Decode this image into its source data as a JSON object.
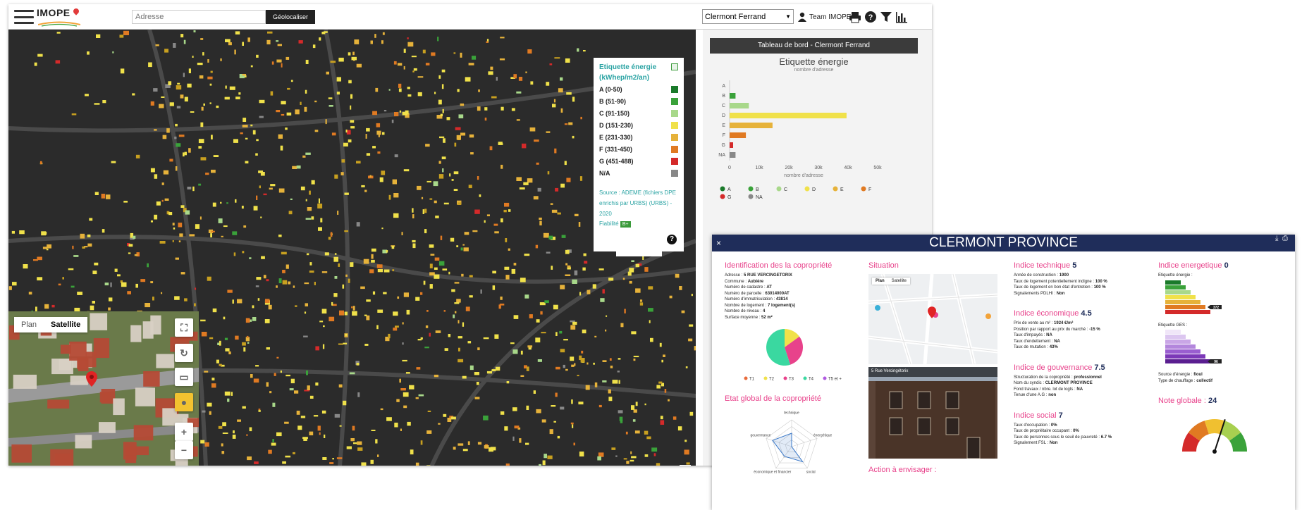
{
  "app": {
    "logo_text": "IMOPE",
    "address_placeholder": "Adresse",
    "geocode_button": "Géolocaliser",
    "city_selected": "Clermont Ferrand",
    "user_label": "Team IMOPE"
  },
  "legend": {
    "title": "Etiquette énergie (kWhep/m2/an)",
    "items": [
      {
        "label": "A (0-50)",
        "color": "#1a7a2a"
      },
      {
        "label": "B (51-90)",
        "color": "#3aa23a"
      },
      {
        "label": "C (91-150)",
        "color": "#a8d88a"
      },
      {
        "label": "D (151-230)",
        "color": "#f0e14a"
      },
      {
        "label": "E (231-330)",
        "color": "#e6b23a"
      },
      {
        "label": "F (331-450)",
        "color": "#e07a22"
      },
      {
        "label": "G (451-488)",
        "color": "#d42a2a"
      },
      {
        "label": "N/A",
        "color": "#888888"
      }
    ],
    "source": "Source : ADEME (fichiers DPE enrichis par URBS) (URBS) - 2020",
    "fidelity_label": "Fiabilité",
    "fidelity_value": "B+"
  },
  "satellite": {
    "tab_plan": "Plan",
    "tab_satellite": "Satellite"
  },
  "dashboard": {
    "header": "Tableau de bord - Clermont Ferrand",
    "chart_title": "Etiquette énergie",
    "chart_subtitle": "nombre d'adresse",
    "x_axis_label": "nombre d'adresse",
    "legend_items": [
      {
        "name": "A",
        "color": "#1a7a2a"
      },
      {
        "name": "B",
        "color": "#3aa23a"
      },
      {
        "name": "C",
        "color": "#a8d88a"
      },
      {
        "name": "D",
        "color": "#f0e14a"
      },
      {
        "name": "E",
        "color": "#e6b23a"
      },
      {
        "name": "F",
        "color": "#e07a22"
      },
      {
        "name": "G",
        "color": "#d42a2a"
      },
      {
        "name": "NA",
        "color": "#888888"
      }
    ]
  },
  "chart_data": {
    "type": "bar",
    "orientation": "horizontal",
    "categories": [
      "A",
      "B",
      "C",
      "D",
      "E",
      "F",
      "G",
      "NA"
    ],
    "values": [
      0,
      2000,
      6500,
      39500,
      14500,
      5500,
      1200,
      2000
    ],
    "xlabel": "nombre d'adresse",
    "xlim": [
      0,
      50000
    ],
    "xticks": [
      "0",
      "10k",
      "20k",
      "30k",
      "40k",
      "50k"
    ],
    "colors": [
      "#1a7a2a",
      "#3aa23a",
      "#a8d88a",
      "#f0e14a",
      "#e6b23a",
      "#e07a22",
      "#d42a2a",
      "#888888"
    ]
  },
  "panel": {
    "title": "CLERMONT PROVINCE",
    "close": "×",
    "identification": {
      "title": "Identification des la copropriété",
      "rows": [
        {
          "label": "Adresse : ",
          "value": "5 RUE VERCINGETORIX"
        },
        {
          "label": "Commune : ",
          "value": "Aubière"
        },
        {
          "label": "Numéro de cadastre : ",
          "value": "AT"
        },
        {
          "label": "Numéro de parcelle : ",
          "value": "63014000AT"
        },
        {
          "label": "Numéro d'immatriculation : ",
          "value": "43814"
        },
        {
          "label": "Nombre de logement : ",
          "value": "7 logement(s)"
        },
        {
          "label": "Nombre de niveau : ",
          "value": "4"
        },
        {
          "label": "Surface moyenne : ",
          "value": "52 m²"
        }
      ],
      "pie_legend": [
        "T1",
        "T2",
        "T3",
        "T4",
        "T5 et +"
      ],
      "pie_colors": [
        "#e86a3a",
        "#f0e14a",
        "#e8428b",
        "#3ad8a0",
        "#b05ae0"
      ],
      "pie_values": [
        0,
        15,
        30,
        55,
        0
      ]
    },
    "etat_global": {
      "title": "Etat global de la copropriété",
      "axes": [
        "technique",
        "énergétique",
        "social",
        "économique et financier",
        "gouvernance"
      ]
    },
    "situation": {
      "title": "Situation",
      "map_tab_plan": "Plan",
      "map_tab_satellite": "Satellite",
      "street_caption": "5 Rue Vercingétorix"
    },
    "technique": {
      "title": "Indice technique",
      "score": "5",
      "rows": [
        {
          "label": "Année de construction : ",
          "value": "1900"
        },
        {
          "label": "Taux de logement potentiellement indigne : ",
          "value": "100 %"
        },
        {
          "label": "Taux de logement en bon état d'entretien : ",
          "value": "100 %"
        },
        {
          "label": "Signalements PDLHI : ",
          "value": "Non"
        }
      ]
    },
    "economique": {
      "title": "Indice économique",
      "score": "4.5",
      "rows": [
        {
          "label": "Prix de vente au m² : ",
          "value": "1924 €/m²"
        },
        {
          "label": "Position par rapport au prix du marché : ",
          "value": "-15 %"
        },
        {
          "label": "Taux d'impayés : ",
          "value": "NA"
        },
        {
          "label": "Taux d'endettement : ",
          "value": "NA"
        },
        {
          "label": "Taux de mutation : ",
          "value": "43%"
        }
      ]
    },
    "gouvernance": {
      "title": "Indice de gouvernance",
      "score": "7.5",
      "rows": [
        {
          "label": "Structuration de la copropriété : ",
          "value": "professionnel"
        },
        {
          "label": "Nom du syndic : ",
          "value": "CLERMONT PROVINCE"
        },
        {
          "label": "Fond travaux / nbre. lot de logts : ",
          "value": "NA"
        },
        {
          "label": "Tenue d'une A.G : ",
          "value": "non"
        }
      ]
    },
    "social": {
      "title": "Indice social",
      "score": "7",
      "rows": [
        {
          "label": "Taux d'occupation : ",
          "value": "0%"
        },
        {
          "label": "Taux de propriétaire occupant : ",
          "value": "0%"
        },
        {
          "label": "Taux de personnes sous le seuil de pauvreté : ",
          "value": "6.7 %"
        },
        {
          "label": "Signalement FSL : ",
          "value": "Non"
        }
      ]
    },
    "action": {
      "title": "Action à envisager :"
    },
    "energetique": {
      "title": "Indice energetique",
      "score": "0",
      "label_energie": "Etiquette énergie :",
      "label_ges": "Etiquette GES :",
      "energy_value": "372",
      "ges_value": "96",
      "rows": [
        {
          "label": "Source d'énergie : ",
          "value": "fioul"
        },
        {
          "label": "Type de chauffage : ",
          "value": "collectif"
        }
      ]
    },
    "note_globale": {
      "title": "Note globale :",
      "value": "24",
      "max": 40
    }
  }
}
